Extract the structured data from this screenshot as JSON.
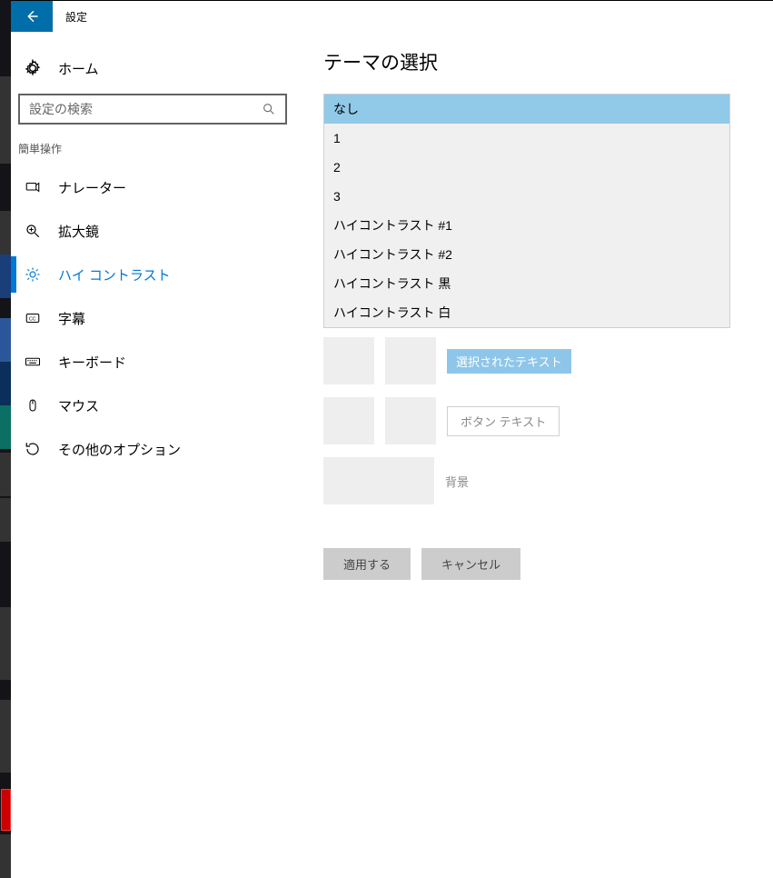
{
  "window_title": "設定",
  "home_label": "ホーム",
  "search_placeholder": "設定の検索",
  "section_label": "簡単操作",
  "nav": {
    "narrator": "ナレーター",
    "magnifier": "拡大鏡",
    "high_contrast": "ハイ コントラスト",
    "captions": "字幕",
    "keyboard": "キーボード",
    "mouse": "マウス",
    "other": "その他のオプション"
  },
  "page_title": "テーマの選択",
  "theme_options": {
    "0": "なし",
    "1": "1",
    "2": "2",
    "3": "3",
    "4": "ハイコントラスト #1",
    "5": "ハイコントラスト #2",
    "6": "ハイコントラスト 黒",
    "7": "ハイコントラスト 白"
  },
  "selected_theme_index": 0,
  "preview": {
    "selected_text": "選択されたテキスト",
    "button_text": "ボタン テキスト",
    "background": "背景"
  },
  "actions": {
    "apply": "適用する",
    "cancel": "キャンセル"
  }
}
